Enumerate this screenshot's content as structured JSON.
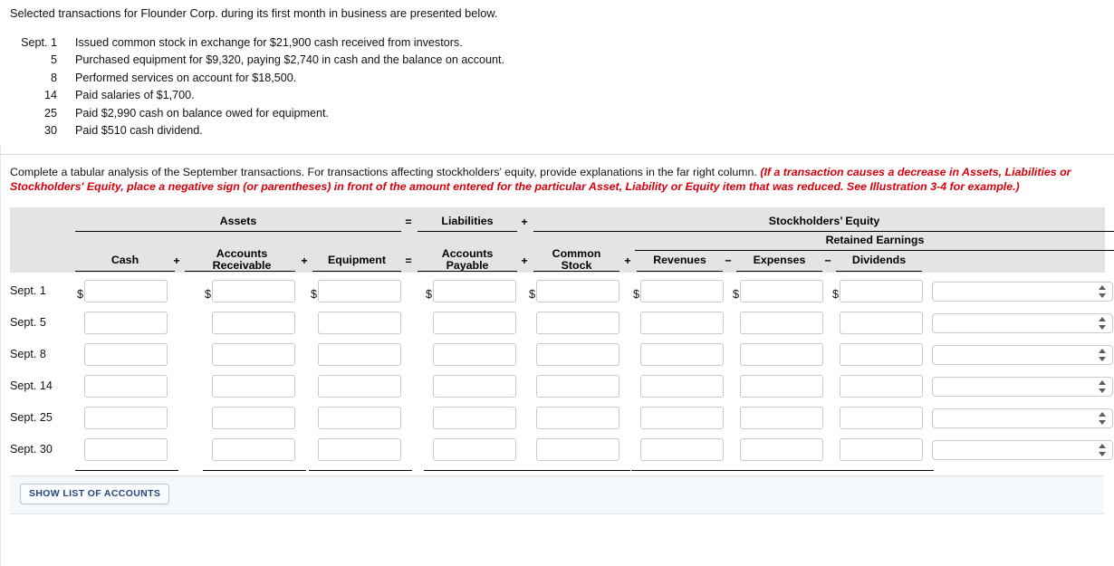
{
  "problem": {
    "intro": "Selected transactions for Flounder Corp. during its first month in business are presented below.",
    "transactions": [
      {
        "date": "Sept. 1",
        "description": "Issued common stock in exchange for $21,900 cash received from investors."
      },
      {
        "date": "5",
        "description": "Purchased equipment for $9,320, paying $2,740 in cash and the balance on account."
      },
      {
        "date": "8",
        "description": "Performed services on account for $18,500."
      },
      {
        "date": "14",
        "description": "Paid salaries of $1,700."
      },
      {
        "date": "25",
        "description": "Paid $2,990 cash on balance owed for equipment."
      },
      {
        "date": "30",
        "description": "Paid $510 cash dividend."
      }
    ]
  },
  "instruction": {
    "normal": "Complete a tabular analysis of the September transactions. For transactions affecting stockholders’ equity, provide explanations in the far right column.",
    "emphasis": "(If a transaction causes a decrease in Assets, Liabilities or Stockholders' Equity, place a negative sign (or parentheses) in front of the amount entered for the particular Asset, Liability or Equity item that was reduced. See Illustration 3-4 for example.)",
    "emphasis_color": "#d8000c"
  },
  "worksheet": {
    "group_headers": {
      "assets": "Assets",
      "liabilities": "Liabilities",
      "stockholders_equity": "Stockholders’ Equity",
      "retained_earnings": "Retained Earnings"
    },
    "group_operators": {
      "assets_eq_liab": "=",
      "liab_plus_se": "+"
    },
    "columns": [
      {
        "label": "Cash",
        "op_after": "+"
      },
      {
        "label": "Accounts\nReceivable",
        "op_after": "+"
      },
      {
        "label": "Equipment",
        "op_after": "="
      },
      {
        "label": "Accounts\nPayable",
        "op_after": "+"
      },
      {
        "label": "Common\nStock",
        "op_after": "+"
      },
      {
        "label": "Revenues",
        "op_after": "−"
      },
      {
        "label": "Expenses",
        "op_after": "−"
      },
      {
        "label": "Dividends",
        "op_after": ""
      }
    ],
    "column_labels_flat": [
      "Cash",
      "Accounts Receivable",
      "Equipment",
      "Accounts Payable",
      "Common Stock",
      "Revenues",
      "Expenses",
      "Dividends"
    ],
    "rows": [
      {
        "date": "Sept. 1",
        "values": [
          "",
          "",
          "",
          "",
          "",
          "",
          "",
          ""
        ],
        "explanation": ""
      },
      {
        "date": "Sept. 5",
        "values": [
          "",
          "",
          "",
          "",
          "",
          "",
          "",
          ""
        ],
        "explanation": ""
      },
      {
        "date": "Sept. 8",
        "values": [
          "",
          "",
          "",
          "",
          "",
          "",
          "",
          ""
        ],
        "explanation": ""
      },
      {
        "date": "Sept. 14",
        "values": [
          "",
          "",
          "",
          "",
          "",
          "",
          "",
          ""
        ],
        "explanation": ""
      },
      {
        "date": "Sept. 25",
        "values": [
          "",
          "",
          "",
          "",
          "",
          "",
          "",
          ""
        ],
        "explanation": ""
      },
      {
        "date": "Sept. 30",
        "values": [
          "",
          "",
          "",
          "",
          "",
          "",
          "",
          ""
        ],
        "explanation": ""
      }
    ],
    "totals": {
      "date": "",
      "values": [
        "",
        "",
        "",
        "",
        "",
        "",
        "",
        ""
      ],
      "equals_sign": "="
    },
    "currency_symbol": "$",
    "explanation_placeholder": "",
    "explanation_options": [
      ""
    ],
    "header_background": "#e4e4e4"
  },
  "footer": {
    "show_accounts_label": "SHOW LIST OF ACCOUNTS",
    "bar_background": "#f4f8fb",
    "button_text_color": "#25477e"
  }
}
